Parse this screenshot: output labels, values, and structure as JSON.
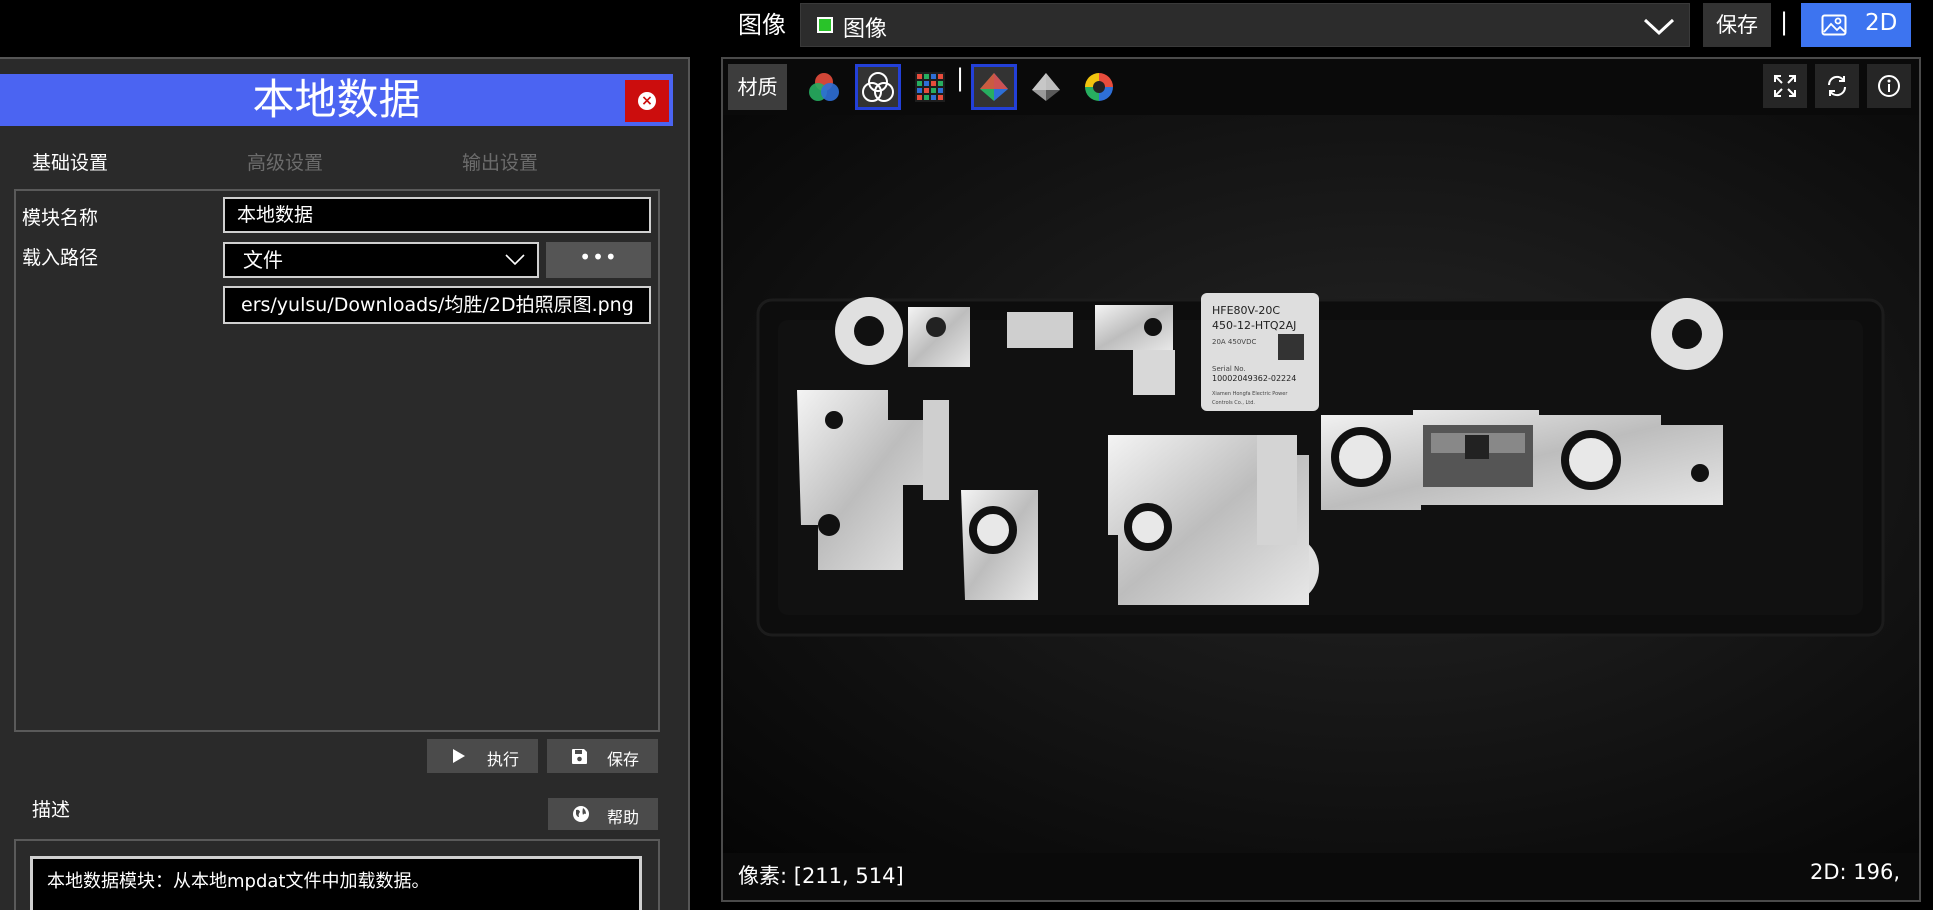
{
  "topbar": {
    "label": "图像",
    "select_value": "图像",
    "save_label": "保存",
    "separator": "|",
    "mode_label": "2D",
    "accent_color": "#3d74f0"
  },
  "panel": {
    "title": "本地数据",
    "header_color": "#4b64f2",
    "close_color": "#cc0d0d",
    "tabs": [
      "基础设置",
      "高级设置",
      "输出设置"
    ],
    "fields": {
      "name_label": "模块名称",
      "name_value": "本地数据",
      "path_label": "载入路径",
      "path_type": "文件",
      "browse": "•••",
      "path_value": "ers/yulsu/Downloads/均胜/2D拍照原图.png"
    },
    "run_label": "执行",
    "save_label": "保存",
    "desc_label": "描述",
    "help_label": "帮助",
    "desc_text": "本地数据模块：从本地mpdat文件中加载数据。"
  },
  "viewer": {
    "material_label": "材质",
    "tools": [
      "rgb-channels-icon",
      "mono-channels-icon",
      "color-grid-icon",
      "color-pyramid-icon",
      "gray-pyramid-icon",
      "color-wheel-icon"
    ],
    "tool_separator": "|",
    "corner_buttons": [
      "fullscreen-icon",
      "refresh-icon",
      "info-icon"
    ],
    "pixel_readout": "像素: [211, 514]",
    "coord_readout": "2D: 196,",
    "label_text": {
      "line1": "HFE80V-20C",
      "line2": "450-12-HTQ2AJ",
      "line3": "20A 450VDC",
      "line4": "Serial No.",
      "line5": "10002049362-02224",
      "line6": "Xiamen Hongfa Electric Power",
      "line7": "Controls Co., Ltd."
    }
  }
}
